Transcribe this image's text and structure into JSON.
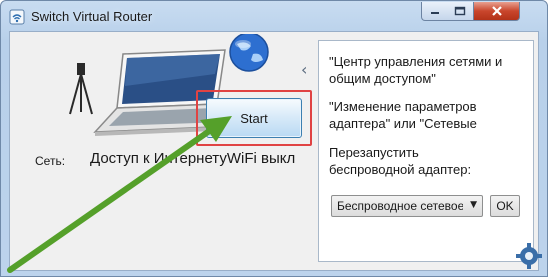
{
  "window": {
    "title": "Switch Virtual Router"
  },
  "main": {
    "start_label": "Start",
    "network_label": "Сеть:",
    "network_value": "Доступ к ИнтернетуWiFi выкл"
  },
  "info": {
    "link1": "\"Центр управления сетями и общим доступом\"",
    "link2": "\"Изменение параметров адаптера\" или \"Сетевые",
    "restart_label": "Перезапустить беспроводной адаптер:",
    "adapter_select": "Беспроводное сетевое соединение",
    "ok_label": "OK"
  },
  "colors": {
    "highlight_frame": "#e04343",
    "arrow": "#55a02a",
    "titlebar": "#c8dcf1"
  }
}
